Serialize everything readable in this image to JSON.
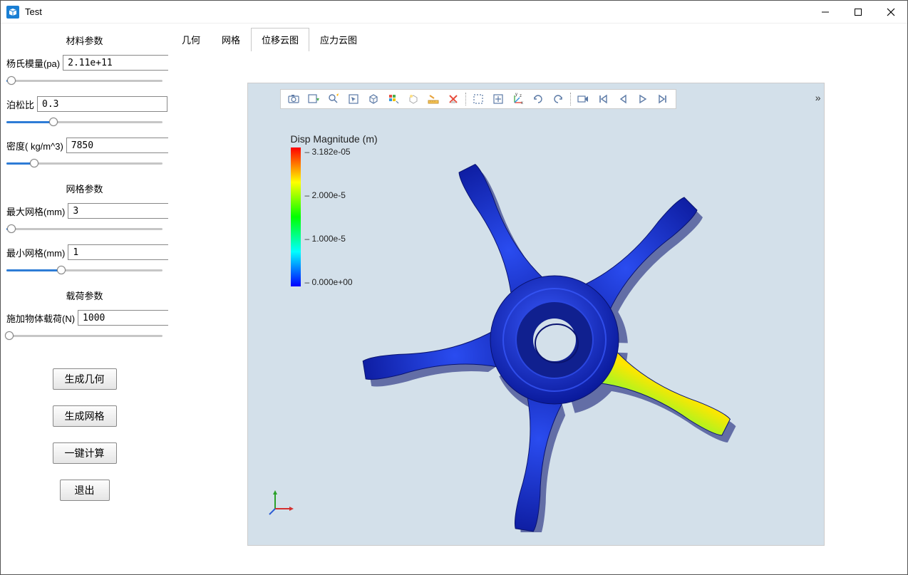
{
  "window": {
    "title": "Test"
  },
  "sidebar": {
    "material": {
      "title": "材料参数",
      "youngs_label": "杨氏模量(pa)",
      "youngs_value": "2.11e+11",
      "poisson_label": "泊松比",
      "poisson_value": "0.3",
      "density_label": "密度( kg/m^3)",
      "density_value": "7850"
    },
    "mesh": {
      "title": "网格参数",
      "max_label": "最大网格(mm)",
      "max_value": "3",
      "min_label": "最小网格(mm)",
      "min_value": "1"
    },
    "load": {
      "title": "载荷参数",
      "body_label": "施加物体载荷(N)",
      "body_value": "1000"
    },
    "buttons": {
      "gen_geometry": "生成几何",
      "gen_mesh": "生成网格",
      "compute": "一键计算",
      "exit": "退出"
    }
  },
  "tabs": {
    "geometry": "几何",
    "mesh": "网格",
    "disp_cloud": "位移云图",
    "stress_cloud": "应力云图",
    "active": "disp_cloud"
  },
  "viewer": {
    "legend": {
      "title": "Disp Magnitude (m)",
      "ticks": [
        "3.182e-05",
        "2.000e-5",
        "1.000e-5",
        "0.000e+00"
      ]
    },
    "toolbar_icons": [
      "camera-icon",
      "save-image-icon",
      "zoom-fit-icon",
      "select-box-icon",
      "cube-icon",
      "color-mapping-icon",
      "light-icon",
      "ruler-icon",
      "clear-icon",
      "select-rect-icon",
      "fit-data-icon",
      "axes-icon",
      "rotate-cw-icon",
      "rotate-ccw-icon",
      "video-icon",
      "first-frame-icon",
      "prev-frame-icon",
      "play-icon",
      "next-frame-icon"
    ]
  },
  "colors": {
    "accent": "#2e7cd6",
    "viewer_bg": "#d3e0ea",
    "model_blue": "#1636c3"
  }
}
